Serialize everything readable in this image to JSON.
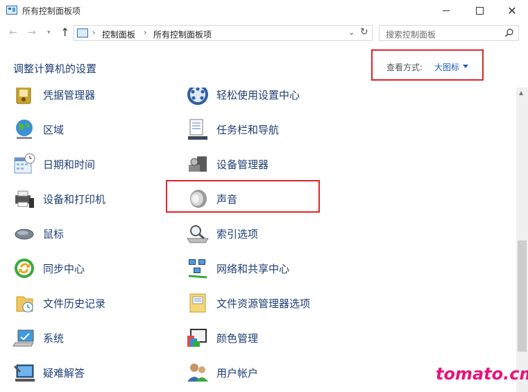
{
  "window": {
    "title": "所有控制面板项"
  },
  "address_bar": {
    "crumbs": [
      "控制面板",
      "所有控制面板项"
    ]
  },
  "search": {
    "placeholder": "搜索控制面板"
  },
  "header": {
    "title": "调整计算机的设置",
    "view_label": "查看方式:",
    "view_value": "大图标"
  },
  "items_left": [
    {
      "label": "凭据管理器",
      "icon": "credential-manager-icon"
    },
    {
      "label": "区域",
      "icon": "region-globe-icon"
    },
    {
      "label": "日期和时间",
      "icon": "date-time-icon"
    },
    {
      "label": "设备和打印机",
      "icon": "devices-printers-icon"
    },
    {
      "label": "鼠标",
      "icon": "mouse-icon"
    },
    {
      "label": "同步中心",
      "icon": "sync-center-icon"
    },
    {
      "label": "文件历史记录",
      "icon": "file-history-icon"
    },
    {
      "label": "系统",
      "icon": "system-icon"
    },
    {
      "label": "疑难解答",
      "icon": "troubleshooting-icon"
    }
  ],
  "items_right": [
    {
      "label": "轻松使用设置中心",
      "icon": "ease-of-access-icon"
    },
    {
      "label": "任务栏和导航",
      "icon": "taskbar-navigation-icon"
    },
    {
      "label": "设备管理器",
      "icon": "device-manager-icon"
    },
    {
      "label": "声音",
      "icon": "sound-speaker-icon"
    },
    {
      "label": "索引选项",
      "icon": "indexing-options-icon"
    },
    {
      "label": "网络和共享中心",
      "icon": "network-sharing-icon"
    },
    {
      "label": "文件资源管理器选项",
      "icon": "file-explorer-options-icon"
    },
    {
      "label": "颜色管理",
      "icon": "color-management-icon"
    },
    {
      "label": "用户帐户",
      "icon": "user-accounts-icon"
    }
  ],
  "watermark": "tomato.cm",
  "colors": {
    "link": "#1e3f74",
    "highlight_border": "#e0242a",
    "watermark": "#e9127a"
  }
}
